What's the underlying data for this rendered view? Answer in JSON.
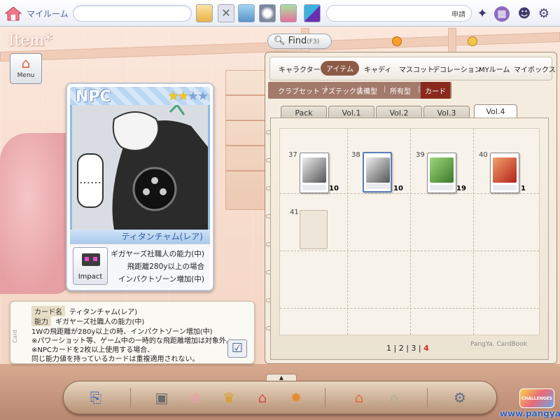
{
  "topbar": {
    "room_title": "マイルーム",
    "chat_apply": "申請"
  },
  "side": {
    "item_title": "Item*",
    "menu_label": "Menu"
  },
  "card": {
    "npc_label": "NPC",
    "stars_total": 4,
    "stars_filled": 2,
    "name": "ティタンチャム(レア)",
    "speech": "……",
    "impact_label": "Impact",
    "desc_lines": [
      "ギガヤーズ社職人の能力(中)",
      "飛距離280y以上の場合",
      "インパクトゾーン増加(中)"
    ]
  },
  "info": {
    "side_label": "Card",
    "name_key": "カード名",
    "name_value": "ティタンチャム(レア)",
    "ability_key": "能力",
    "ability_value": "ギガヤーズ社職人の能力(中)",
    "lines": [
      "1Wの飛距離が280y以上の時、インパクトゾーン増加(中)",
      "※パワーショット等、ゲーム中の一時的な飛距離増加は対象外。",
      "※NPCカードを2枚以上使用する場合、",
      "同じ能力値を持っているカードは重複適用されない。"
    ]
  },
  "find": {
    "label": "Find",
    "shortcut": "(F3)"
  },
  "categories": {
    "items": [
      "キャラクター",
      "アイテム",
      "キャディ",
      "マスコット",
      "デコレーション",
      "MYルーム",
      "マイボックス"
    ],
    "active": "アイテム"
  },
  "subcats": {
    "items": [
      "クラブセット",
      "アズテック",
      "装備型",
      "所有型",
      "カード"
    ],
    "active": "カード"
  },
  "vol_tabs": {
    "items": [
      "Pack",
      "Vol.1",
      "Vol.2",
      "Vol.3",
      "Vol.4"
    ],
    "active": "Vol.4"
  },
  "book": {
    "slots": [
      {
        "num": "37",
        "count": "10",
        "art": "mono"
      },
      {
        "num": "38",
        "count": "10",
        "art": "mono",
        "selected": true
      },
      {
        "num": "39",
        "count": "19",
        "art": "green"
      },
      {
        "num": "40",
        "count": "1",
        "art": "red"
      },
      {
        "num": "41",
        "count": "",
        "art": "empty"
      }
    ],
    "pages": [
      "1",
      "2",
      "3",
      "4"
    ],
    "current_page": "4",
    "signature": "PangYa. CardBook"
  },
  "footer": {
    "site": "www.pangya.jp",
    "badge": "CHALLENGES"
  },
  "colors": {
    "accent_brown": "#8c5a46",
    "sub_bar": "#a2796b",
    "current_page": "#d62a1e",
    "star_on": "#f4c524"
  }
}
